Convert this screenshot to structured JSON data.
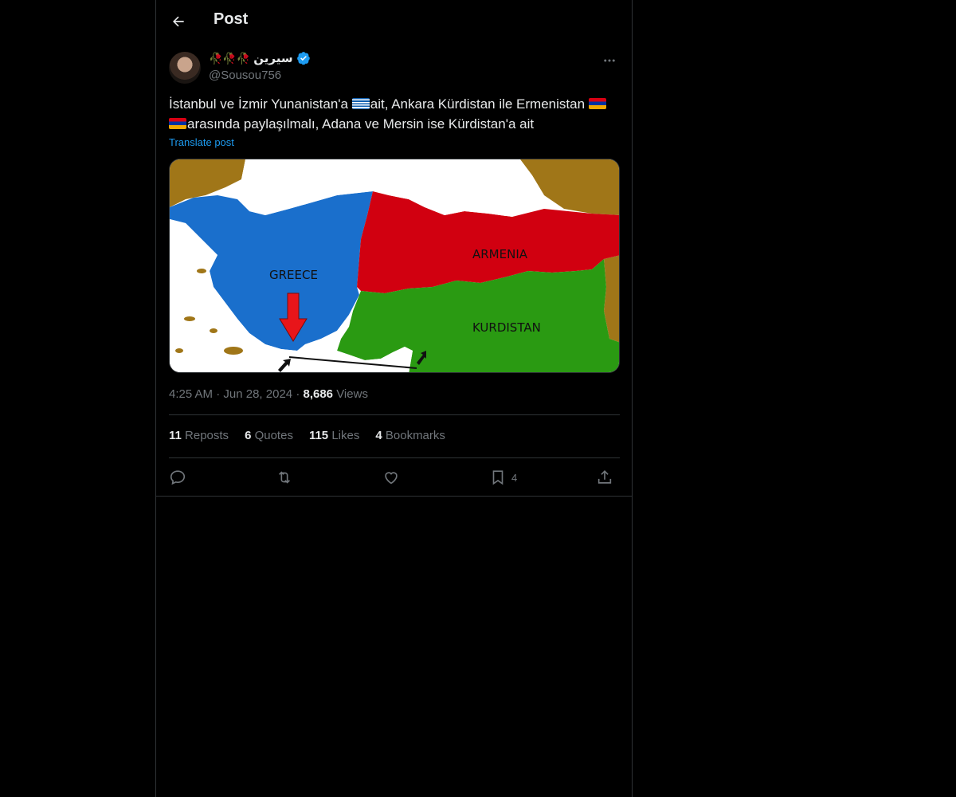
{
  "header": {
    "title": "Post"
  },
  "author": {
    "name": "سيرين",
    "handle": "@Sousou756",
    "name_emoji": "🥀🥀🥀"
  },
  "tweet": {
    "text_part1": "İstanbul ve İzmir Yunanistan'a ",
    "text_part2": "ait, Ankara Kürdistan ile Ermenistan ",
    "text_part3": "arasında paylaşılmalı, Adana ve Mersin ise Kürdistan'a ait",
    "translate_label": "Translate post"
  },
  "map": {
    "labels": {
      "greece": "GREECE",
      "armenia": "ARMENIA",
      "kurdistan": "KURDISTAN"
    }
  },
  "meta": {
    "time": "4:25 AM",
    "date": "Jun 28, 2024",
    "views_count": "8,686",
    "views_label": "Views"
  },
  "stats": [
    {
      "count": "11",
      "label": "Reposts"
    },
    {
      "count": "6",
      "label": "Quotes"
    },
    {
      "count": "115",
      "label": "Likes"
    },
    {
      "count": "4",
      "label": "Bookmarks"
    }
  ],
  "actions": {
    "bookmark_count": "4"
  },
  "colors": {
    "accent": "#1d9bf0",
    "greece": "#1a6fcc",
    "armenia": "#d10010",
    "kurdistan": "#2a9a12"
  }
}
